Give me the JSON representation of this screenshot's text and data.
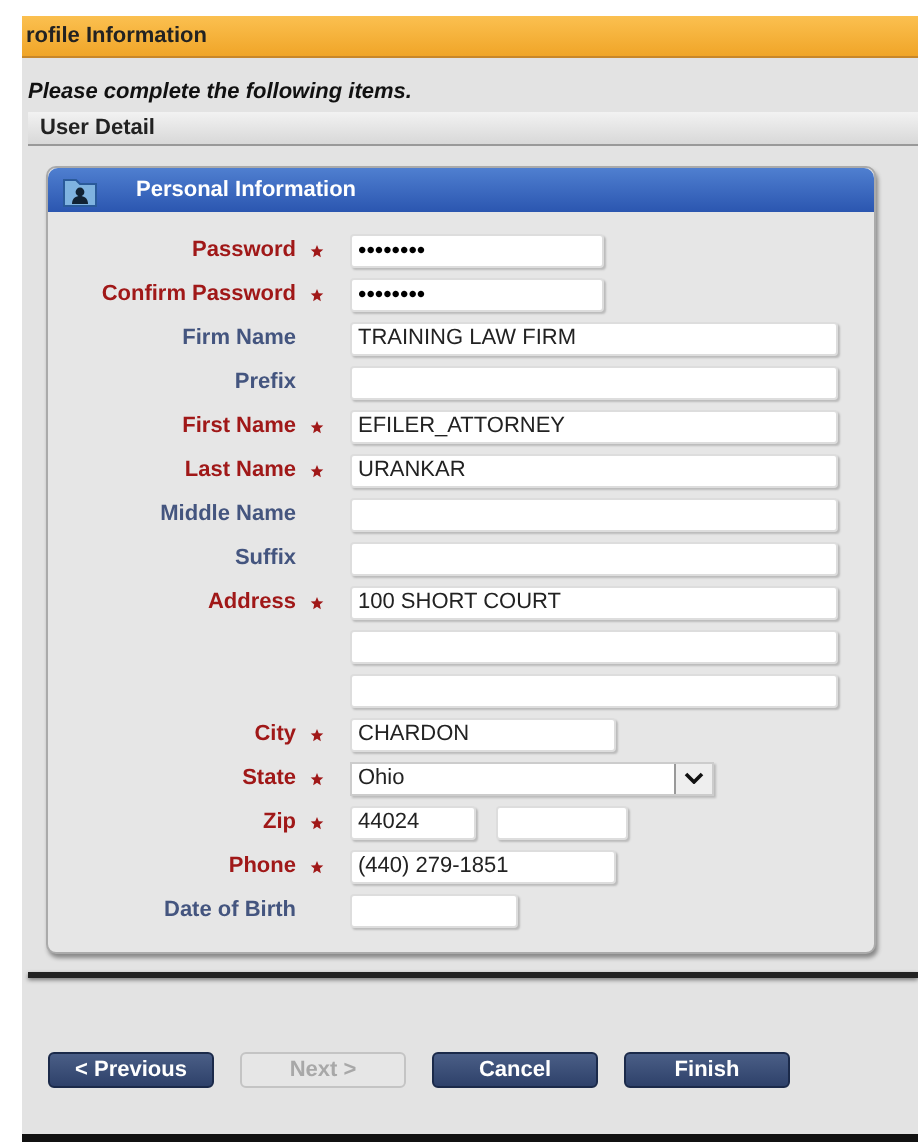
{
  "header": {
    "title": "rofile Information"
  },
  "instructions": "Please complete the following items.",
  "section": {
    "title": "User Detail"
  },
  "card": {
    "title": "Personal Information",
    "fields": [
      {
        "kind": "password",
        "label": "Password",
        "required": true,
        "value": "••••••••"
      },
      {
        "kind": "password",
        "label": "Confirm Password",
        "required": true,
        "value": "••••••••"
      },
      {
        "kind": "long",
        "label": "Firm Name",
        "required": false,
        "value": "TRAINING LAW FIRM"
      },
      {
        "kind": "long",
        "label": "Prefix",
        "required": false
      },
      {
        "kind": "long",
        "label": "First Name",
        "required": true,
        "value": "EFILER_ATTORNEY"
      },
      {
        "kind": "long",
        "label": "Last Name",
        "required": true,
        "value": "URANKAR"
      },
      {
        "kind": "long",
        "label": "Middle Name",
        "required": false
      },
      {
        "kind": "long",
        "label": "Suffix",
        "required": false
      },
      {
        "kind": "long",
        "label": "Address",
        "required": true,
        "value": "100 SHORT COURT"
      },
      {
        "kind": "long"
      },
      {
        "kind": "long"
      },
      {
        "kind": "medium",
        "label": "City",
        "required": true,
        "value": "CHARDON"
      },
      {
        "kind": "select",
        "label": "State",
        "required": true,
        "value": "Ohio"
      },
      {
        "kind": "zip",
        "label": "Zip",
        "required": true,
        "value": "44024"
      },
      {
        "kind": "medium",
        "label": "Phone",
        "required": true,
        "value": "(440) 279-1851"
      },
      {
        "kind": "short",
        "label": "Date of Birth",
        "required": false
      }
    ]
  },
  "buttons": [
    {
      "label": "< Previous",
      "disabled": false
    },
    {
      "label": "Next >",
      "disabled": true
    },
    {
      "label": "Cancel",
      "disabled": false
    },
    {
      "label": "Finish",
      "disabled": false
    }
  ]
}
